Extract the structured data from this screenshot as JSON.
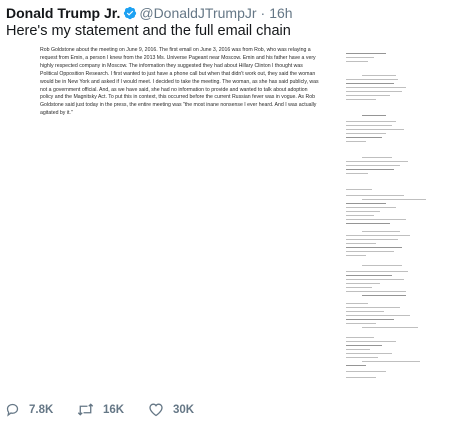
{
  "tweet": {
    "author_name": "Donald Trump Jr.",
    "handle": "@DonaldJTrumpJr",
    "separator": "·",
    "time": "16h",
    "text": "Here's my statement and the full email chain"
  },
  "media": {
    "statement_text": "Rob Goldstone about the meeting on June 9, 2016. The first email on June 3, 2016 was from Rob, who was relaying a request from Emin, a person I knew from the 2013 Ms. Universe Pageant near Moscow. Emin and his father have a very highly respected company in Moscow. The information they suggested they had about Hillary Clinton I thought was Political Opposition Research. I first wanted to just have a phone call but when that didn't work out, they said the woman would be in New York and asked if I would meet. I decided to take the meeting. The woman, as she has said publicly, was not a government official. And, as we have said, she had no information to provide and wanted to talk about adoption policy and the Magnitsky Act. To put this in context, this occurred before the current Russian fever was in vogue. As Rob Goldstone said just today in the press, the entire meeting was \"the most inane nonsense I ever heard. And I was actually agitated by it.\""
  },
  "actions": {
    "reply_count": "7.8K",
    "retweet_count": "16K",
    "like_count": "30K"
  },
  "colors": {
    "text": "#14171a",
    "secondary": "#657786",
    "verified_badge": "#1da1f2",
    "icon": "#657786"
  }
}
